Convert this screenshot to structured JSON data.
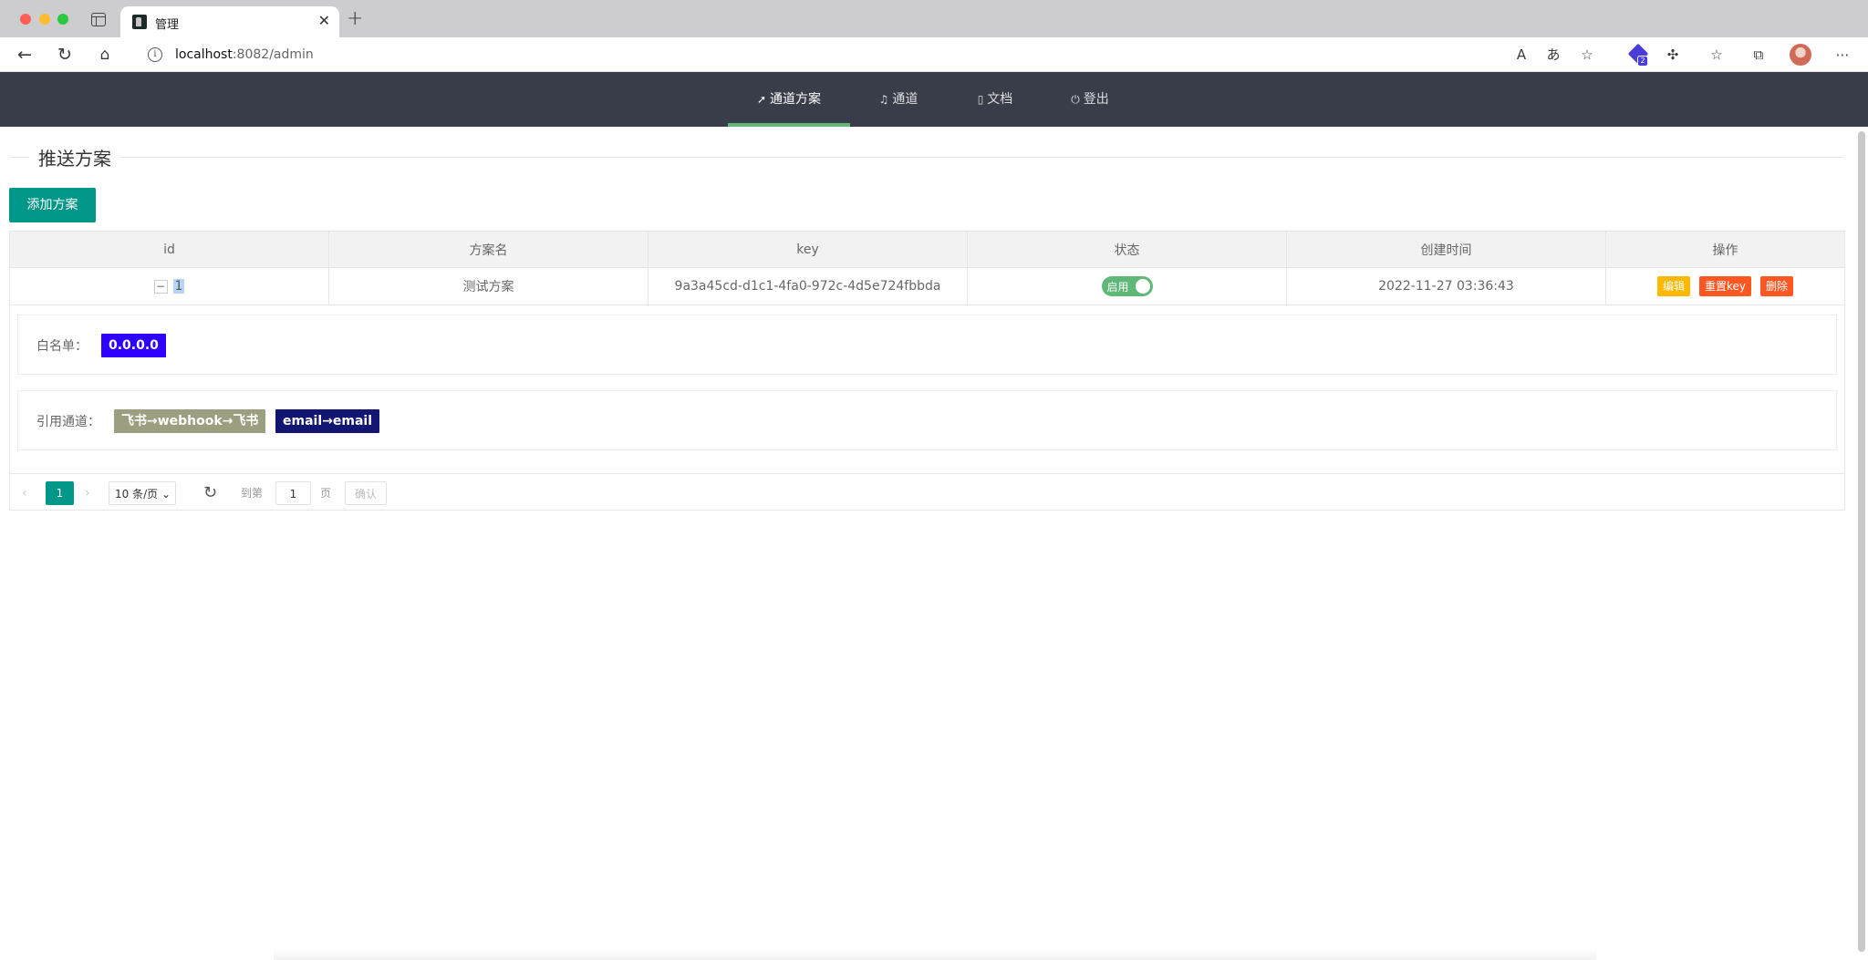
{
  "browser": {
    "tab_title": "管理",
    "close_glyph": "✕",
    "new_tab_glyph": "+",
    "url_host": "localhost",
    "url_rest": ":8082/admin",
    "extension_count": "2"
  },
  "nav": {
    "items": [
      {
        "label": "通道方案",
        "icon": "paper-plane-icon",
        "active": true
      },
      {
        "label": "通道",
        "icon": "bell-icon",
        "active": false
      },
      {
        "label": "文档",
        "icon": "file-icon",
        "active": false
      },
      {
        "label": "登出",
        "icon": "power-icon",
        "active": false
      }
    ],
    "accent": "#5fb878"
  },
  "page": {
    "legend": "推送方案",
    "add_button": "添加方案"
  },
  "table": {
    "headers": [
      "id",
      "方案名",
      "key",
      "状态",
      "创建时间",
      "操作"
    ],
    "rows": [
      {
        "id": "1",
        "name": "测试方案",
        "key": "9a3a45cd-d1c1-4fa0-972c-4d5e724fbbda",
        "status": "启用",
        "status_on": true,
        "created": "2022-11-27 03:36:43",
        "actions": [
          "编辑",
          "重置key",
          "删除"
        ]
      }
    ]
  },
  "detail": {
    "whitelist_label": "白名单：",
    "whitelist": [
      "0.0.0.0"
    ],
    "channels_label": "引用通道：",
    "channels": [
      "飞书→webhook→飞书",
      "email→email"
    ]
  },
  "pagination": {
    "current": "1",
    "limit": "10 条/页",
    "goto_label": "到第",
    "goto_value": "1",
    "page_unit": "页",
    "confirm": "确认"
  },
  "colors": {
    "primary": "#009688",
    "header": "#393d49",
    "warm": "#ffb800",
    "danger": "#ff5722",
    "whitelist_tag": "#2f00ff",
    "channel_tag_1": "#9b9e7f",
    "channel_tag_2": "#131573"
  }
}
